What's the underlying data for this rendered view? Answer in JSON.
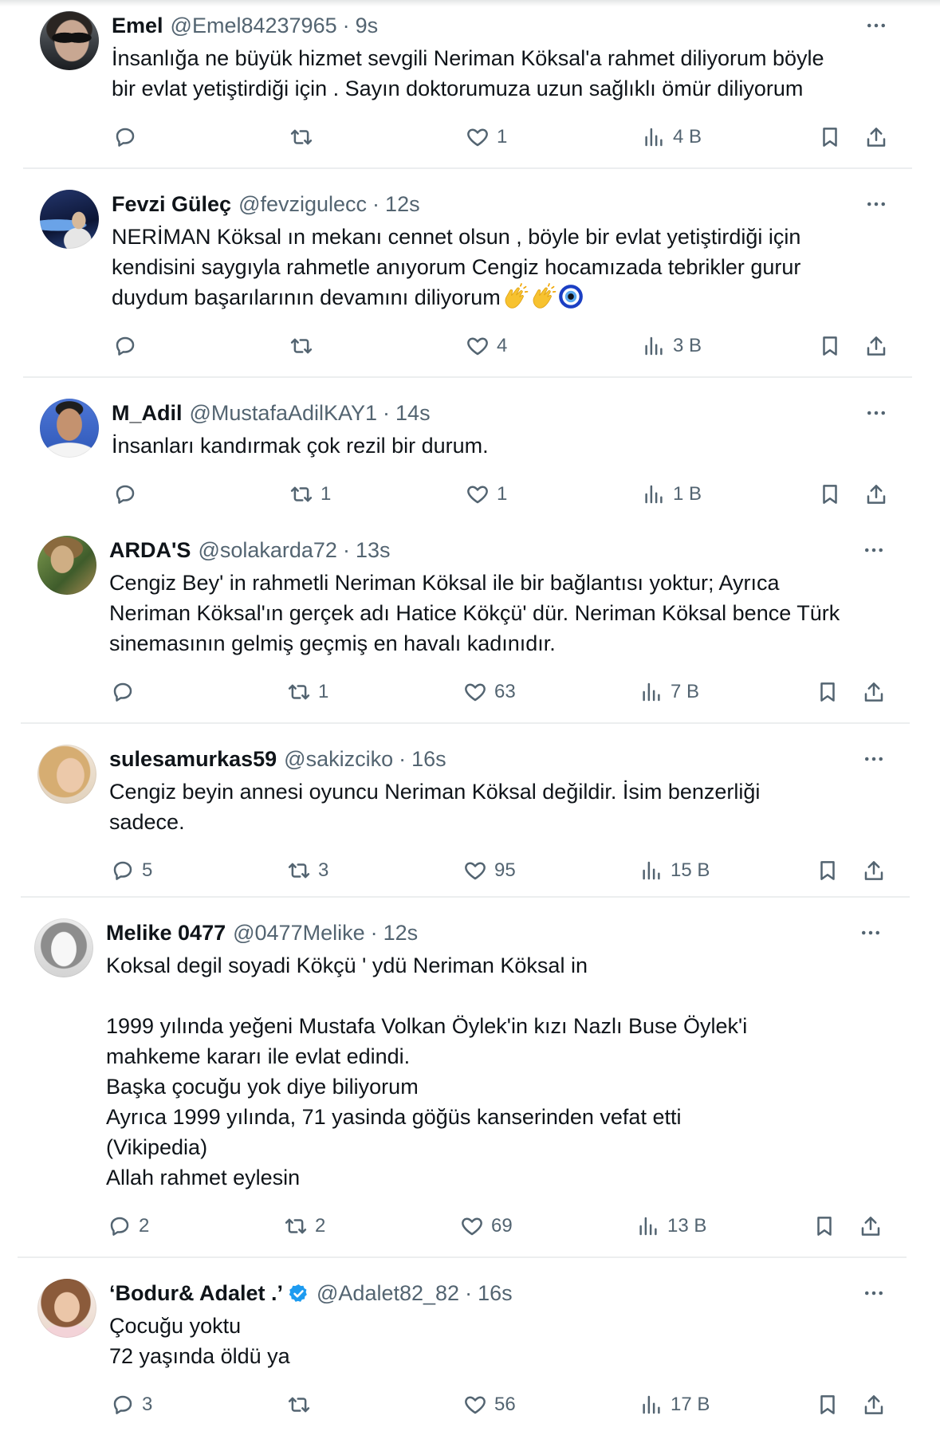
{
  "separator": "·",
  "colors": {
    "text": "#0f1419",
    "secondary": "#536471",
    "divider": "#eceeef",
    "verified": "#1d9bf0"
  },
  "icons": {
    "reply": "reply-icon",
    "retweet": "retweet-icon",
    "like": "heart-icon",
    "views": "views-icon",
    "bookmark": "bookmark-icon",
    "share": "share-icon",
    "more": "more-icon",
    "verified": "verified-badge-icon"
  },
  "tweets": [
    {
      "name": "Emel",
      "handle": "@Emel84237965",
      "time": "9s",
      "lines": [
        "İnsanlığa ne büyük hizmet sevgili Neriman Köksal'a rahmet diliyorum böyle",
        "bir evlat yetiştirdiği için . Sayın doktorumuza uzun sağlıklı ömür diliyorum"
      ],
      "stats": {
        "likes": "1",
        "views": "4 B"
      }
    },
    {
      "name": "Fevzi Güleç",
      "handle": "@fevzigulecc",
      "time": "12s",
      "lines": [
        "NERİMAN Köksal ın mekanı cennet olsun , böyle bir evlat yetiştirdiği için",
        "kendisini saygıyla rahmetle anıyorum Cengiz hocamızada tebrikler gurur",
        "duydum başarılarının devamını diliyorum"
      ],
      "emojis": [
        "clapping-hands",
        "clapping-hands",
        "nazar-amulet"
      ],
      "stats": {
        "likes": "4",
        "views": "3 B"
      }
    },
    {
      "name": "M_Adil",
      "handle": "@MustafaAdilKAY1",
      "time": "14s",
      "lines": [
        "İnsanları kandırmak çok rezil bir durum."
      ],
      "stats": {
        "retweets": "1",
        "likes": "1",
        "views": "1 B"
      }
    },
    {
      "name": "ARDA'S",
      "handle": "@solakarda72",
      "time": "13s",
      "lines": [
        "Cengiz Bey' in rahmetli Neriman Köksal ile bir bağlantısı yoktur; Ayrıca",
        "Neriman Köksal'ın gerçek adı Hatice Kökçü' dür. Neriman Köksal bence Türk",
        "sinemasının gelmiş geçmiş en havalı kadınıdır."
      ],
      "stats": {
        "retweets": "1",
        "likes": "63",
        "views": "7 B"
      }
    },
    {
      "name": "sulesamurkas59",
      "handle": "@sakizciko",
      "time": "16s",
      "lines": [
        "Cengiz beyin annesi oyuncu Neriman Köksal değildir. İsim benzerliği",
        "sadece."
      ],
      "stats": {
        "replies": "5",
        "retweets": "3",
        "likes": "95",
        "views": "15 B"
      }
    },
    {
      "name": "Melike 0477",
      "handle": "@0477Melike",
      "time": "12s",
      "lines": [
        "Koksal degil soyadi Kökçü ' ydü Neriman Köksal in",
        "",
        "1999 yılında yeğeni Mustafa Volkan Öylek'in kızı Nazlı Buse Öylek'i",
        "mahkeme kararı ile evlat edindi.",
        "Başka çocuğu yok diye biliyorum",
        "Ayrıca 1999 yılında, 71 yasinda göğüs kanserinden vefat etti",
        "(Vikipedia)",
        "Allah rahmet eylesin"
      ],
      "stats": {
        "replies": "2",
        "retweets": "2",
        "likes": "69",
        "views": "13 B"
      }
    },
    {
      "name": "‘Bodur& Adalet .’",
      "verified": true,
      "handle": "@Adalet82_82",
      "time": "16s",
      "lines": [
        "Çocuğu yoktu",
        "72 yaşında öldü ya"
      ],
      "stats": {
        "replies": "3",
        "likes": "56",
        "views": "17 B"
      }
    }
  ]
}
